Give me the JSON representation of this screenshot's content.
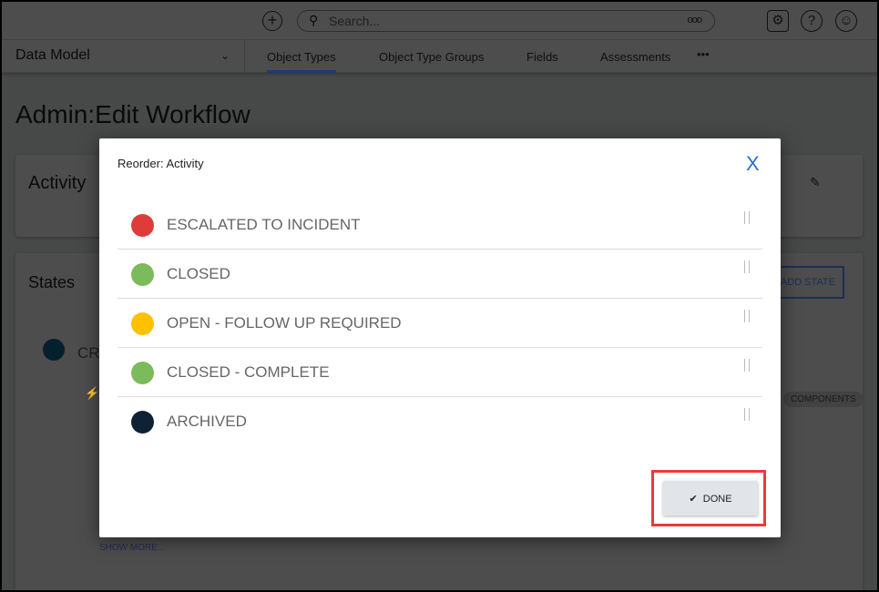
{
  "header": {
    "search_placeholder": "Search...",
    "more_label": "ooo"
  },
  "nav": {
    "section": "Data Model",
    "tabs": [
      "Object Types",
      "Object Type Groups",
      "Fields",
      "Assessments"
    ],
    "more": "•••"
  },
  "page": {
    "title": "Admin:Edit Workflow",
    "activity_heading": "Activity",
    "states_heading": "States",
    "add_state": "ADD STATE",
    "state_partial": "CR",
    "components": "COMPONENTS",
    "show_more": "SHOW MORE..."
  },
  "modal": {
    "title": "Reorder: Activity",
    "close": "X",
    "done_label": "DONE",
    "items": [
      {
        "label": "ESCALATED TO INCIDENT",
        "color": "#e03b3b"
      },
      {
        "label": "CLOSED",
        "color": "#7cbb5c"
      },
      {
        "label": "OPEN - FOLLOW UP REQUIRED",
        "color": "#ffc000"
      },
      {
        "label": "CLOSED - COMPLETE",
        "color": "#7cbb5c"
      },
      {
        "label": "ARCHIVED",
        "color": "#0e2135"
      }
    ]
  }
}
